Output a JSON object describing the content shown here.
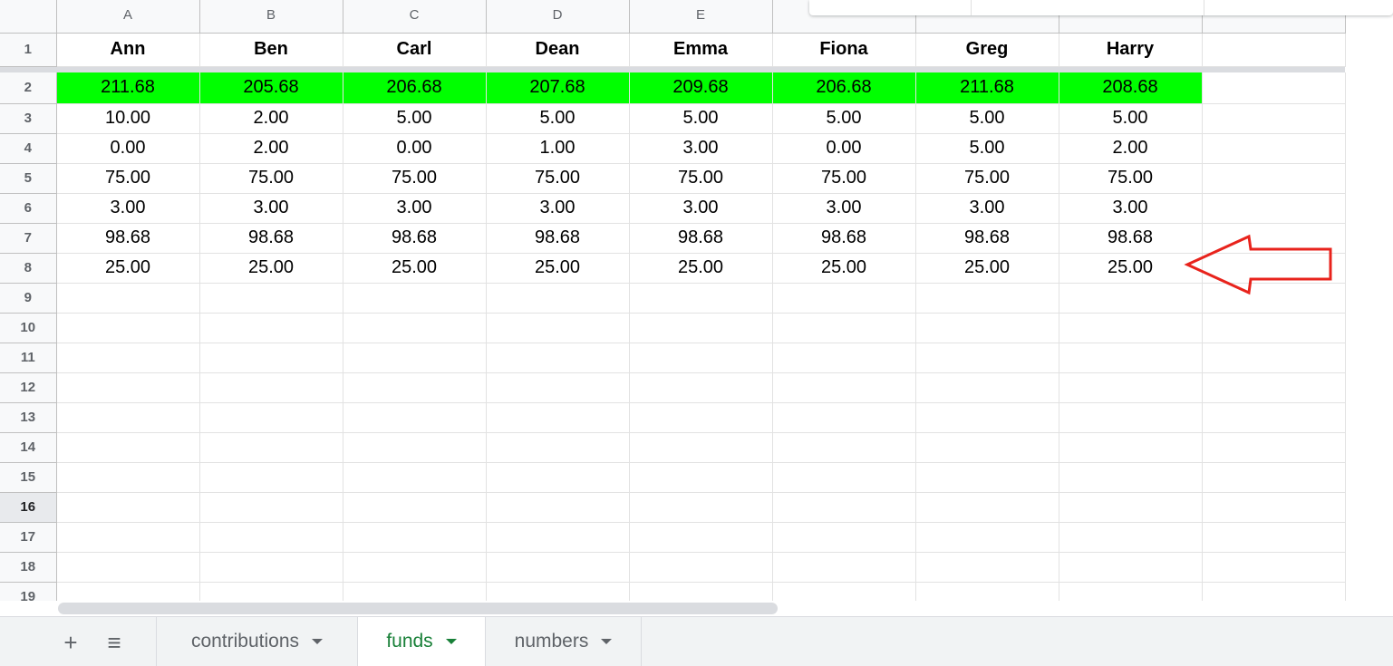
{
  "columns": [
    "A",
    "B",
    "C",
    "D",
    "E",
    "",
    "",
    "",
    ""
  ],
  "rows": [
    {
      "num": "1",
      "cells": [
        "Ann",
        "Ben",
        "Carl",
        "Dean",
        "Emma",
        "Fiona",
        "Greg",
        "Harry",
        ""
      ]
    },
    {
      "num": "2",
      "cells": [
        "211.68",
        "205.68",
        "206.68",
        "207.68",
        "209.68",
        "206.68",
        "211.68",
        "208.68",
        ""
      ]
    },
    {
      "num": "3",
      "cells": [
        "10.00",
        "2.00",
        "5.00",
        "5.00",
        "5.00",
        "5.00",
        "5.00",
        "5.00",
        ""
      ]
    },
    {
      "num": "4",
      "cells": [
        "0.00",
        "2.00",
        "0.00",
        "1.00",
        "3.00",
        "0.00",
        "5.00",
        "2.00",
        ""
      ]
    },
    {
      "num": "5",
      "cells": [
        "75.00",
        "75.00",
        "75.00",
        "75.00",
        "75.00",
        "75.00",
        "75.00",
        "75.00",
        ""
      ]
    },
    {
      "num": "6",
      "cells": [
        "3.00",
        "3.00",
        "3.00",
        "3.00",
        "3.00",
        "3.00",
        "3.00",
        "3.00",
        ""
      ]
    },
    {
      "num": "7",
      "cells": [
        "98.68",
        "98.68",
        "98.68",
        "98.68",
        "98.68",
        "98.68",
        "98.68",
        "98.68",
        ""
      ]
    },
    {
      "num": "8",
      "cells": [
        "25.00",
        "25.00",
        "25.00",
        "25.00",
        "25.00",
        "25.00",
        "25.00",
        "25.00",
        ""
      ]
    },
    {
      "num": "9",
      "cells": [
        "",
        "",
        "",
        "",
        "",
        "",
        "",
        "",
        ""
      ]
    },
    {
      "num": "10",
      "cells": [
        "",
        "",
        "",
        "",
        "",
        "",
        "",
        "",
        ""
      ]
    },
    {
      "num": "11",
      "cells": [
        "",
        "",
        "",
        "",
        "",
        "",
        "",
        "",
        ""
      ]
    },
    {
      "num": "12",
      "cells": [
        "",
        "",
        "",
        "",
        "",
        "",
        "",
        "",
        ""
      ]
    },
    {
      "num": "13",
      "cells": [
        "",
        "",
        "",
        "",
        "",
        "",
        "",
        "",
        ""
      ]
    },
    {
      "num": "14",
      "cells": [
        "",
        "",
        "",
        "",
        "",
        "",
        "",
        "",
        ""
      ]
    },
    {
      "num": "15",
      "cells": [
        "",
        "",
        "",
        "",
        "",
        "",
        "",
        "",
        ""
      ]
    },
    {
      "num": "16",
      "cells": [
        "",
        "",
        "",
        "",
        "",
        "",
        "",
        "",
        ""
      ]
    },
    {
      "num": "17",
      "cells": [
        "",
        "",
        "",
        "",
        "",
        "",
        "",
        "",
        ""
      ]
    },
    {
      "num": "18",
      "cells": [
        "",
        "",
        "",
        "",
        "",
        "",
        "",
        "",
        ""
      ]
    },
    {
      "num": "19",
      "cells": [
        "",
        "",
        "",
        "",
        "",
        "",
        "",
        "",
        ""
      ]
    }
  ],
  "selected_row": "16",
  "highlight_row": "2",
  "highlight_color": "#00ff00",
  "annotation_color": "#e8231c",
  "tabbar": {
    "add_icon": "+",
    "list_icon": "≡",
    "tabs": [
      {
        "label": "contributions",
        "active": false
      },
      {
        "label": "funds",
        "active": true
      },
      {
        "label": "numbers",
        "active": false
      }
    ]
  },
  "colors": {
    "active_tab": "#188038",
    "header_bg": "#f8f9fa"
  }
}
